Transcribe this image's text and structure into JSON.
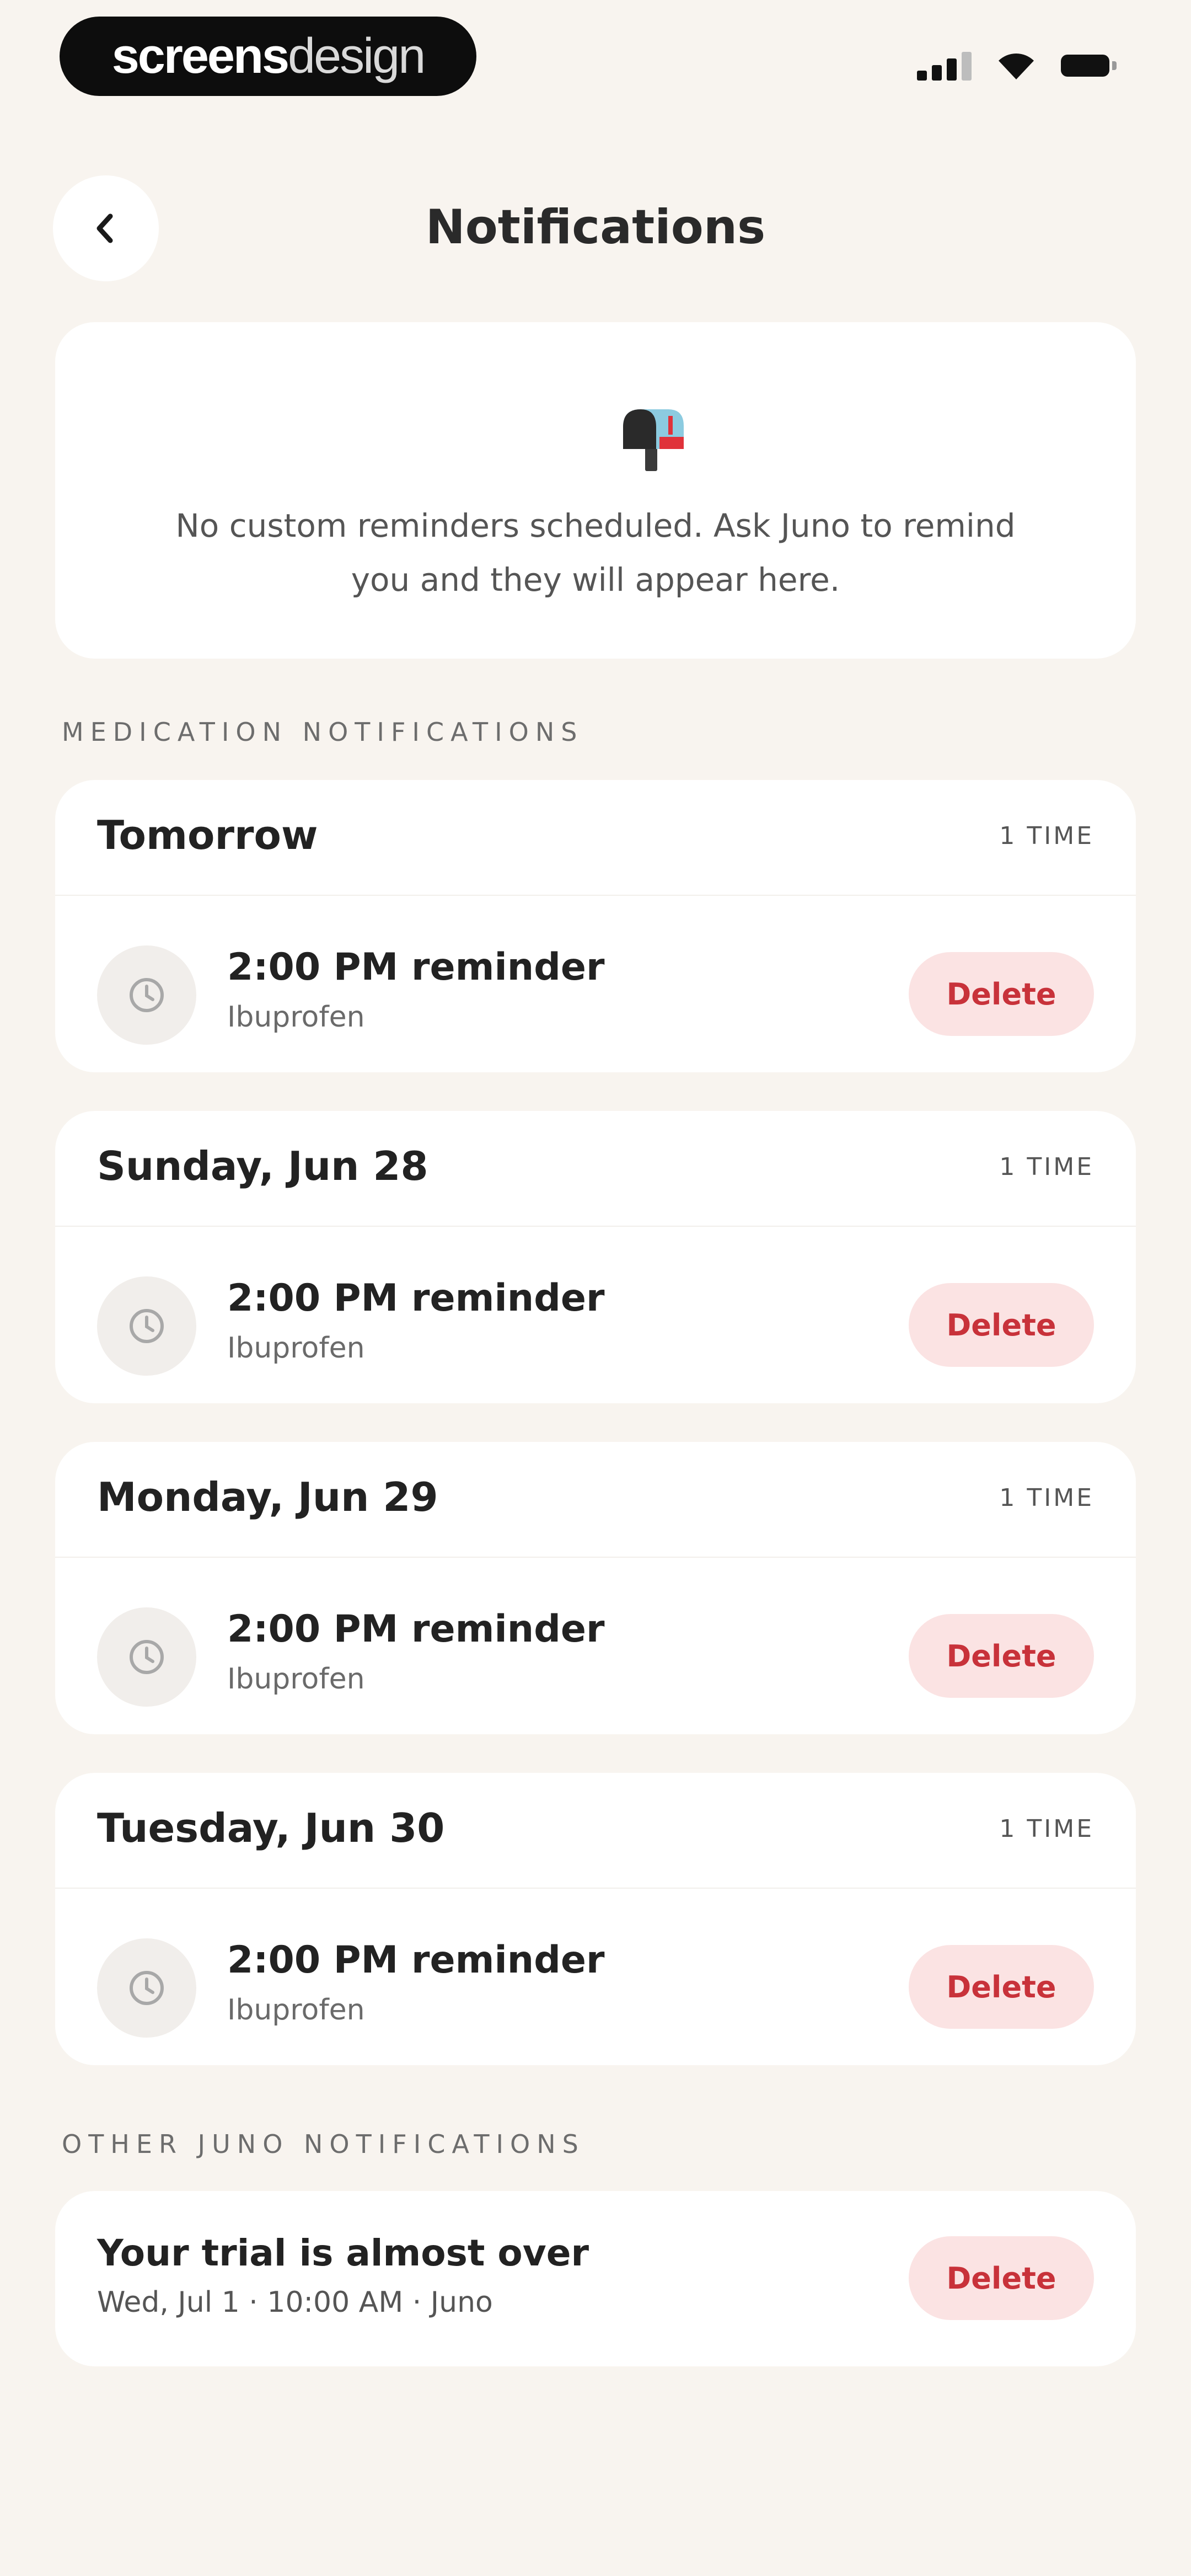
{
  "status_bar": {
    "brand_part1": "screens",
    "brand_part2": "design",
    "icons": [
      "signal-icon",
      "wifi-icon",
      "battery-icon"
    ]
  },
  "header": {
    "back_icon": "chevron-left-icon",
    "title": "Notifications"
  },
  "custom_reminders": {
    "icon": "mailbox-icon",
    "empty_text": "No custom reminders scheduled. Ask Juno to remind you and they will appear here."
  },
  "medication": {
    "section_label": "MEDICATION NOTIFICATIONS",
    "days": [
      {
        "title": "Tomorrow",
        "count": "1 TIME",
        "reminders": [
          {
            "title": "2:00 PM reminder",
            "subtitle": "Ibuprofen",
            "delete_label": "Delete"
          }
        ]
      },
      {
        "title": "Sunday, Jun 28",
        "count": "1 TIME",
        "reminders": [
          {
            "title": "2:00 PM reminder",
            "subtitle": "Ibuprofen",
            "delete_label": "Delete"
          }
        ]
      },
      {
        "title": "Monday, Jun 29",
        "count": "1 TIME",
        "reminders": [
          {
            "title": "2:00 PM reminder",
            "subtitle": "Ibuprofen",
            "delete_label": "Delete"
          }
        ]
      },
      {
        "title": "Tuesday, Jun 30",
        "count": "1 TIME",
        "reminders": [
          {
            "title": "2:00 PM reminder",
            "subtitle": "Ibuprofen",
            "delete_label": "Delete"
          }
        ]
      }
    ]
  },
  "other": {
    "section_label": "OTHER JUNO NOTIFICATIONS",
    "items": [
      {
        "title": "Your trial is almost over",
        "subtitle": "Wed, Jul 1 · 10:00 AM · Juno",
        "delete_label": "Delete"
      }
    ]
  },
  "colors": {
    "background": "#F8F4EF",
    "card": "#FFFFFF",
    "delete_bg": "#FBE3E3",
    "delete_text": "#C8323A"
  }
}
